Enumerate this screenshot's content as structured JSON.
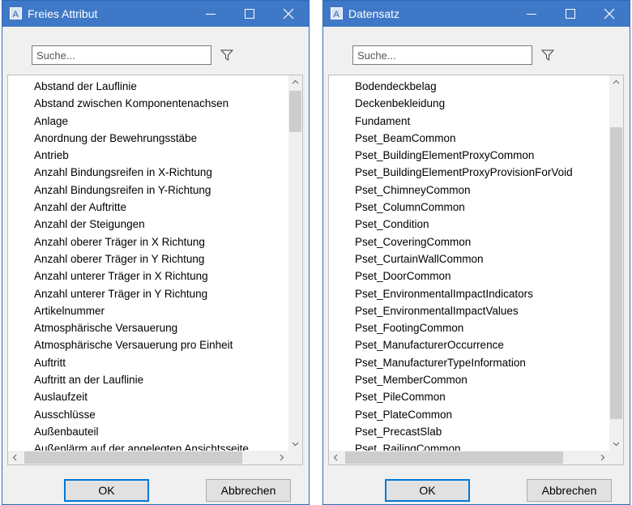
{
  "dialogs": [
    {
      "title": "Freies Attribut",
      "search_placeholder": "Suche...",
      "items": [
        "Abstand der Lauflinie",
        "Abstand zwischen Komponentenachsen",
        "Anlage",
        "Anordnung der Bewehrungsstäbe",
        "Antrieb",
        "Anzahl  Bindungsreifen in X-Richtung",
        "Anzahl Bindungsreifen in Y-Richtung",
        "Anzahl der Auftritte",
        "Anzahl der Steigungen",
        "Anzahl oberer Träger in X Richtung",
        "Anzahl oberer Träger in Y Richtung",
        "Anzahl unterer Träger in X Richtung",
        "Anzahl unterer Träger in Y Richtung",
        "Artikelnummer",
        "Atmosphärische Versauerung",
        "Atmosphärische Versauerung pro Einheit",
        "Auftritt",
        "Auftritt an der Lauflinie",
        "Auslaufzeit",
        "Ausschlüsse",
        "Außenbauteil",
        "Außenlärm auf der angelegten Ansichtsseite"
      ],
      "scroll_position": 0.03,
      "ok_label": "OK",
      "cancel_label": "Abbrechen"
    },
    {
      "title": "Datensatz",
      "search_placeholder": "Suche...",
      "items": [
        "Bodendeckbelag",
        "Deckenbekleidung",
        "Fundament",
        "Pset_BeamCommon",
        "Pset_BuildingElementProxyCommon",
        "Pset_BuildingElementProxyProvisionForVoid",
        "Pset_ChimneyCommon",
        "Pset_ColumnCommon",
        "Pset_Condition",
        "Pset_CoveringCommon",
        "Pset_CurtainWallCommon",
        "Pset_DoorCommon",
        "Pset_EnvironmentalImpactIndicators",
        "Pset_EnvironmentalImpactValues",
        "Pset_FootingCommon",
        "Pset_ManufacturerOccurrence",
        "Pset_ManufacturerTypeInformation",
        "Pset_MemberCommon",
        "Pset_PileCommon",
        "Pset_PlateCommon",
        "Pset_PrecastSlab",
        "Pset_RailingCommon"
      ],
      "scroll_position": 0.0,
      "ok_label": "OK",
      "cancel_label": "Abbrechen"
    }
  ],
  "colors": {
    "titlebar": "#3f78c7",
    "scroll_thumb": "#cdcdcd",
    "ok_focus_border": "#0078d7"
  },
  "icons": [
    "app-icon",
    "minimize-icon",
    "maximize-icon",
    "close-icon",
    "filter-icon",
    "chevron-up-icon",
    "chevron-down-icon",
    "chevron-left-icon",
    "chevron-right-icon"
  ]
}
